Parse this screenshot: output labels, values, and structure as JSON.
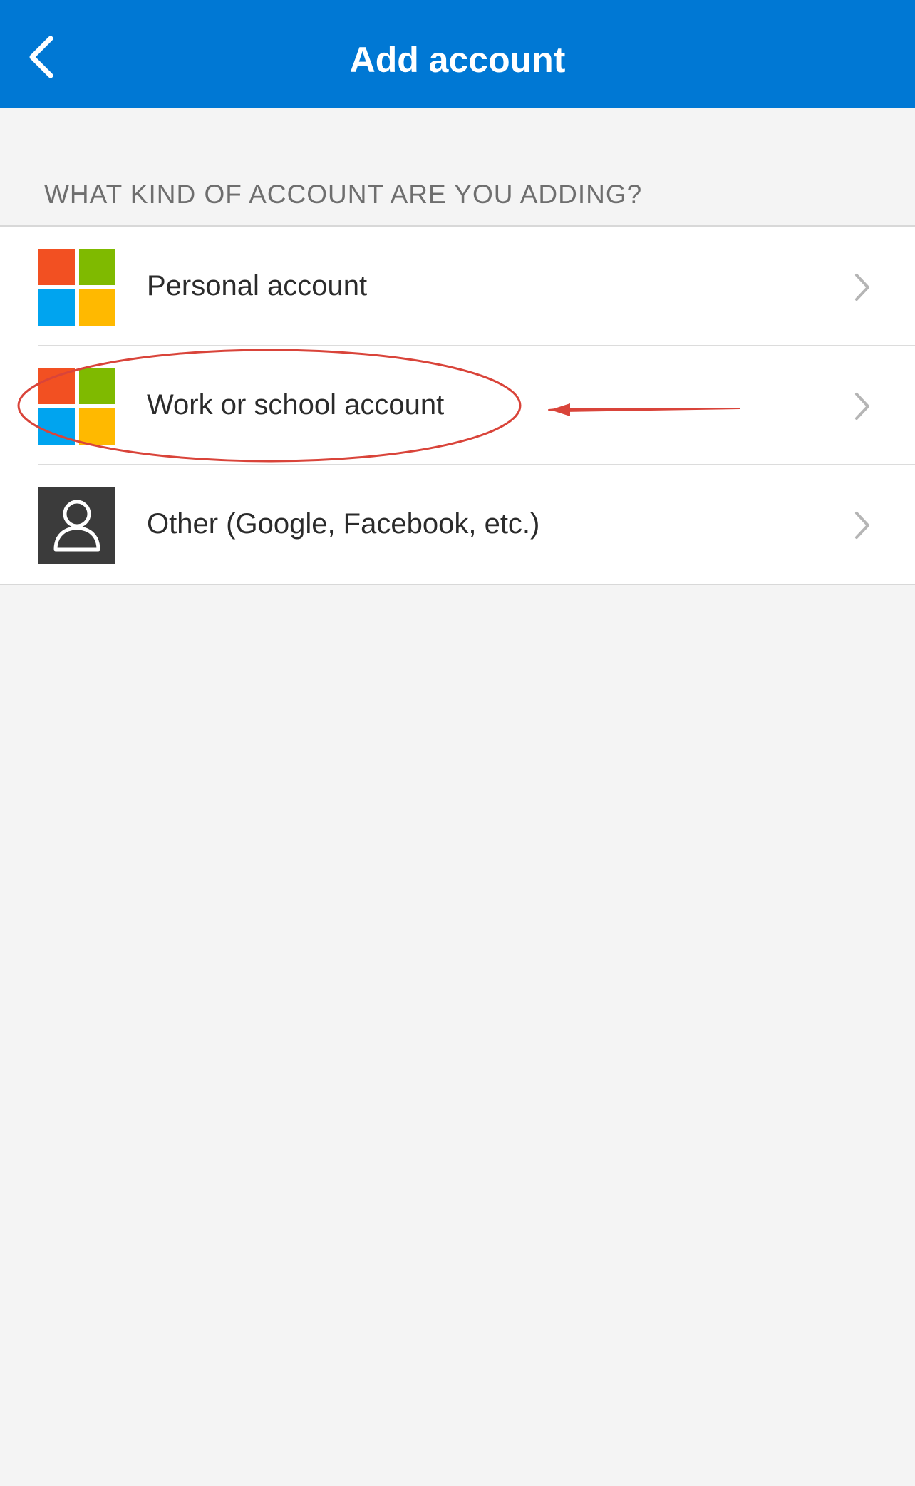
{
  "header": {
    "title": "Add account",
    "back_icon": "chevron-left-icon"
  },
  "section": {
    "label": "WHAT KIND OF ACCOUNT ARE YOU ADDING?"
  },
  "options": [
    {
      "label": "Personal account",
      "icon": "microsoft-logo-icon"
    },
    {
      "label": "Work or school account",
      "icon": "microsoft-logo-icon"
    },
    {
      "label": "Other (Google, Facebook, etc.)",
      "icon": "user-icon"
    }
  ],
  "colors": {
    "header_bg": "#0078d4",
    "page_bg": "#f4f4f4",
    "annotation": "#d9443a"
  }
}
